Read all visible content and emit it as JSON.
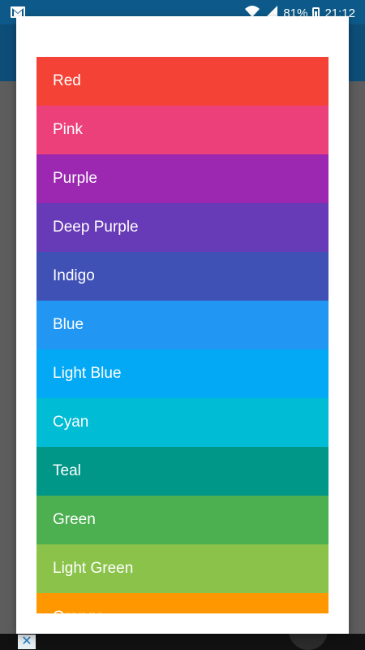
{
  "status_bar": {
    "battery_percent": "81%",
    "time": "21:12",
    "icons": [
      "gmail-icon",
      "wifi-icon",
      "signal-icon",
      "battery-icon"
    ]
  },
  "dialog": {
    "colors": [
      {
        "label": "Red",
        "hex": "#F44336"
      },
      {
        "label": "Pink",
        "hex": "#EC407A"
      },
      {
        "label": "Purple",
        "hex": "#9C27B0"
      },
      {
        "label": "Deep Purple",
        "hex": "#673AB7"
      },
      {
        "label": "Indigo",
        "hex": "#3F51B5"
      },
      {
        "label": "Blue",
        "hex": "#2196F3"
      },
      {
        "label": "Light Blue",
        "hex": "#03A9F4"
      },
      {
        "label": "Cyan",
        "hex": "#00BCD4"
      },
      {
        "label": "Teal",
        "hex": "#009688"
      },
      {
        "label": "Green",
        "hex": "#4CAF50"
      },
      {
        "label": "Light Green",
        "hex": "#8BC34A"
      },
      {
        "label": "Orange",
        "hex": "#FF9800"
      }
    ]
  },
  "ad_bar": {
    "close_symbol": "✕"
  }
}
